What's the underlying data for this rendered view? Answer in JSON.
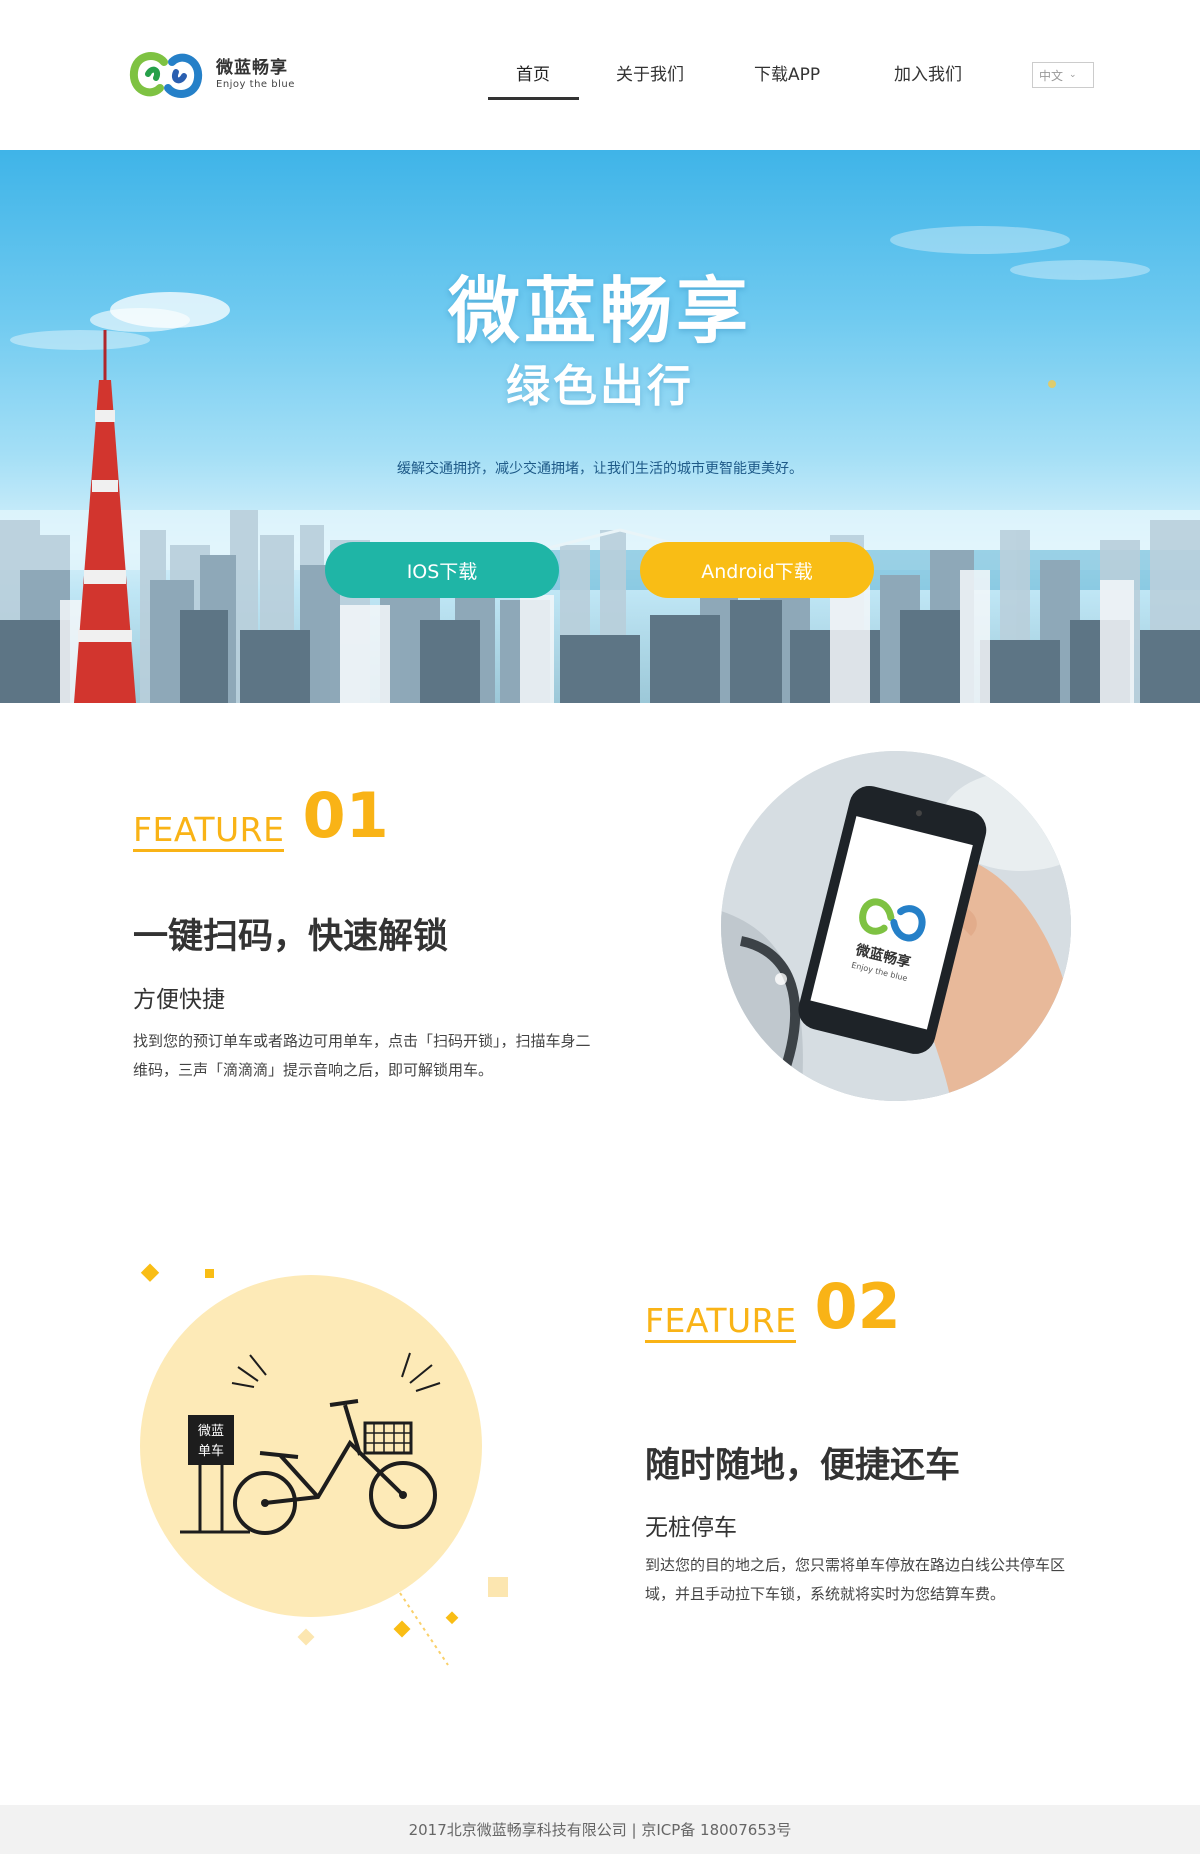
{
  "brand": {
    "name_cn": "微蓝畅享",
    "name_en": "Enjoy the blue"
  },
  "nav": {
    "items": [
      {
        "label": "首页",
        "active": true
      },
      {
        "label": "关于我们",
        "active": false
      },
      {
        "label": "下载APP",
        "active": false
      },
      {
        "label": "加入我们",
        "active": false
      }
    ],
    "language": "中文"
  },
  "hero": {
    "title": "微蓝畅享",
    "subtitle": "绿色出行",
    "description": "缓解交通拥挤，减少交通拥堵，让我们生活的城市更智能更美好。",
    "ios_button": "IOS下载",
    "android_button": "Android下载"
  },
  "features": [
    {
      "word": "FEATURE",
      "number": "01",
      "title": "一键扫码，快速解锁",
      "subtitle": "方便快捷",
      "description_line1": "找到您的预订单车或者路边可用单车，点击「扫码开锁」，扫描车身二",
      "description_line2": "维码，三声「滴滴滴」提示音响之后，即可解锁用车。",
      "phone_logo_cn": "微蓝畅享",
      "phone_logo_en": "Enjoy the blue"
    },
    {
      "word": "FEATURE",
      "number": "02",
      "title": "随时随地，便捷还车",
      "subtitle": "无桩停车",
      "description_line1": "到达您的目的地之后，您只需将单车停放在路边白线公共停车区",
      "description_line2": "域，并且手动拉下车锁，系统就将实时为您结算车费。",
      "sign_line1": "微蓝",
      "sign_line2": "单车"
    }
  ],
  "footer": {
    "text": "2017北京微蓝畅享科技有限公司 | 京ICP备 18007653号"
  },
  "colors": {
    "accent_yellow": "#f9b316",
    "ios_teal": "#1fb5a6",
    "android_yellow": "#f9bd15",
    "bike_circle": "#fdeab7"
  }
}
